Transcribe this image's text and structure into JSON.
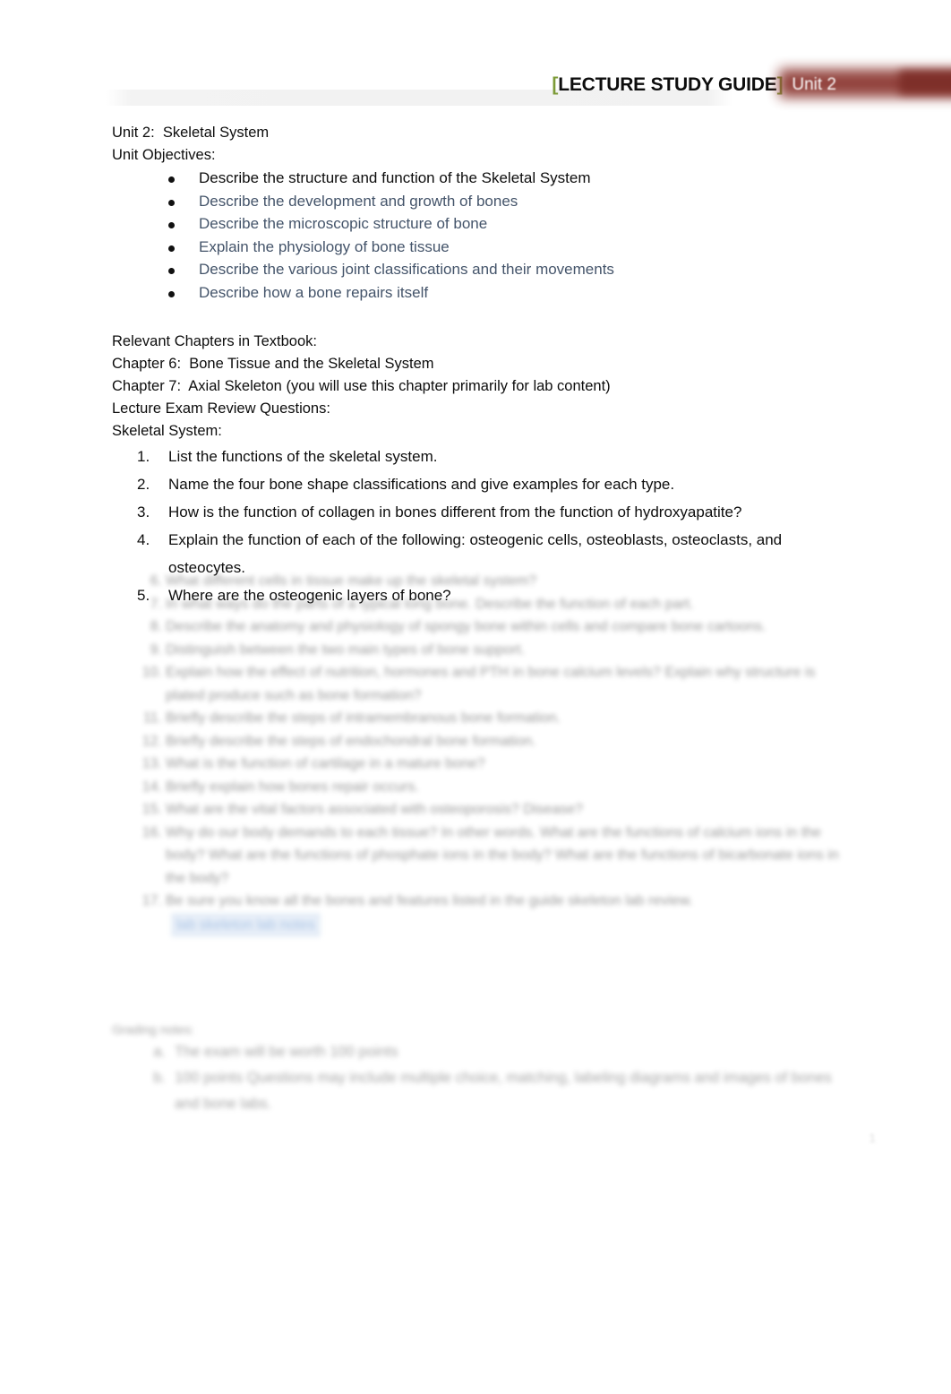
{
  "header": {
    "bracket_open": "[",
    "title": "LECTURE STUDY GUIDE",
    "bracket_close": "]",
    "unit_label": "Unit 2",
    "bracket_color": "#7d9b38",
    "redaction_color": "#8e3b35"
  },
  "document": {
    "unit_line": "Unit 2:  Skeletal System",
    "objectives_heading": "Unit Objectives:",
    "objectives": [
      "Describe the structure and function of the Skeletal System",
      "Describe the development and growth of bones",
      "Describe the microscopic structure of bone",
      "Explain the physiology of bone tissue",
      "Describe the various joint classifications and their movements",
      "Describe how a bone repairs itself"
    ],
    "chapters_heading": "Relevant Chapters in Textbook:",
    "chapter_6": "Chapter 6:  Bone Tissue and the Skeletal System",
    "chapter_7": "Chapter 7:  Axial Skeleton (you will use this chapter primarily for lab content)",
    "exam_heading": "Lecture Exam Review Questions:",
    "section_heading": "Skeletal System:",
    "questions": [
      {
        "num": "1.",
        "text": "List the functions of the skeletal system."
      },
      {
        "num": "2.",
        "text": "Name the four bone shape classifications and give examples for each type."
      },
      {
        "num": "3.",
        "text": "How is the function of collagen in bones different from the function of hydroxyapatite?"
      },
      {
        "num": "4.",
        "text": "Explain the function of each of the following:  osteogenic cells, osteoblasts, osteoclasts, and osteocytes."
      },
      {
        "num": "5.",
        "text": "Where are the osteogenic layers of bone?"
      }
    ]
  },
  "redacted_questions": [
    {
      "num": "6.",
      "text": "What different cells in tissue make up the skeletal system?"
    },
    {
      "num": "7.",
      "text": "In what ways do the parts of a typical long bone.  Describe the function of each part."
    },
    {
      "num": "8.",
      "text": "Describe the anatomy and physiology of spongy bone within cells and compare bone cartoons."
    },
    {
      "num": "9.",
      "text": "Distinguish between the two main types of bone support."
    },
    {
      "num": "10.",
      "text": "Explain how the effect of nutrition, hormones and PTH in bone calcium levels? Explain why structure is plated produce such as bone formation?"
    },
    {
      "num": "11.",
      "text": "Briefly describe the steps of intramembranous bone formation."
    },
    {
      "num": "12.",
      "text": "Briefly describe the steps of endochondral bone formation."
    },
    {
      "num": "13.",
      "text": "What is the function of cartilage in a mature bone?"
    },
    {
      "num": "14.",
      "text": "Briefly explain how bones repair occurs."
    },
    {
      "num": "15.",
      "text": "What are the vital factors associated with osteoporosis?  Disease?"
    },
    {
      "num": "16.",
      "text": "Why do our body demands to each tissue?  In other words.  What are the functions of calcium ions in the body?  What are the functions of phosphate ions in the body?  What are the functions of bicarbonate ions in the body?"
    },
    {
      "num": "17.",
      "text": "Be sure you know all the bones and features listed in the guide skeleton lab review."
    }
  ],
  "redacted_link_text": "lab skeleton lab notes",
  "redacted_footer": {
    "heading": "Grading notes:",
    "items": [
      {
        "num": "a.",
        "text": "The exam will be worth  100 points"
      },
      {
        "num": "b.",
        "text": "100 points  Questions may include multiple choice, matching, labeling diagrams and images of bones and bone labs."
      }
    ]
  },
  "page_number": "1"
}
